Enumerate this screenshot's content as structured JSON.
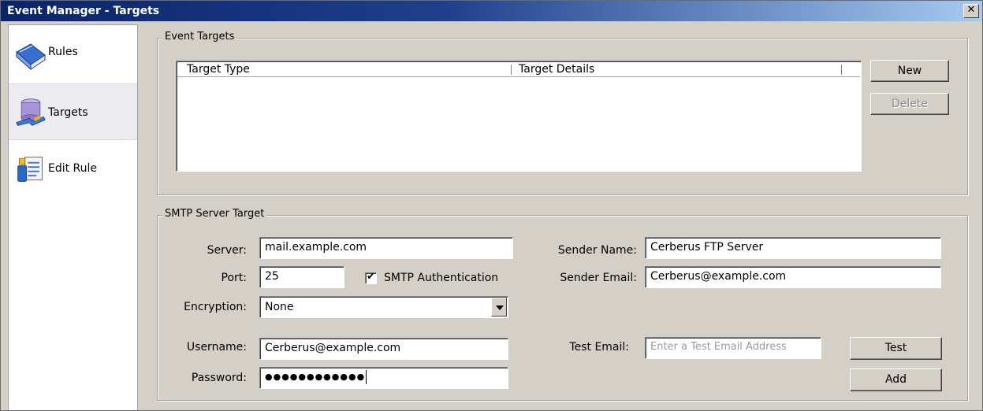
{
  "window": {
    "title": "Event Manager - Targets",
    "close_glyph": "✕"
  },
  "sidebar": {
    "items": [
      {
        "label": "Rules",
        "icon": "book-icon",
        "active": false
      },
      {
        "label": "Targets",
        "icon": "database-icon",
        "active": true
      },
      {
        "label": "Edit Rule",
        "icon": "edit-document-icon",
        "active": false
      }
    ]
  },
  "event_targets": {
    "legend": "Event Targets",
    "columns": [
      "Target Type",
      "Target Details"
    ],
    "rows": [],
    "new_label": "New",
    "delete_label": "Delete"
  },
  "smtp": {
    "legend": "SMTP Server Target",
    "server_label": "Server:",
    "server_value": "mail.example.com",
    "port_label": "Port:",
    "port_value": "25",
    "auth_label": "SMTP Authentication",
    "auth_checked": true,
    "auth_check_glyph": "✔",
    "encryption_label": "Encryption:",
    "encryption_value": "None",
    "username_label": "Username:",
    "username_value": "Cerberus@example.com",
    "password_label": "Password:",
    "password_value": "●●●●●●●●●●●●",
    "sender_name_label": "Sender Name:",
    "sender_name_value": "Cerberus FTP Server",
    "sender_email_label": "Sender Email:",
    "sender_email_value": "Cerberus@example.com",
    "test_email_label": "Test Email:",
    "test_email_placeholder": "Enter a Test Email Address",
    "test_label": "Test",
    "add_label": "Add"
  },
  "colors": {
    "titlebar": "#0a246a",
    "dialog": "#d4d0c8",
    "sidebar_active": "#ecebf0"
  }
}
